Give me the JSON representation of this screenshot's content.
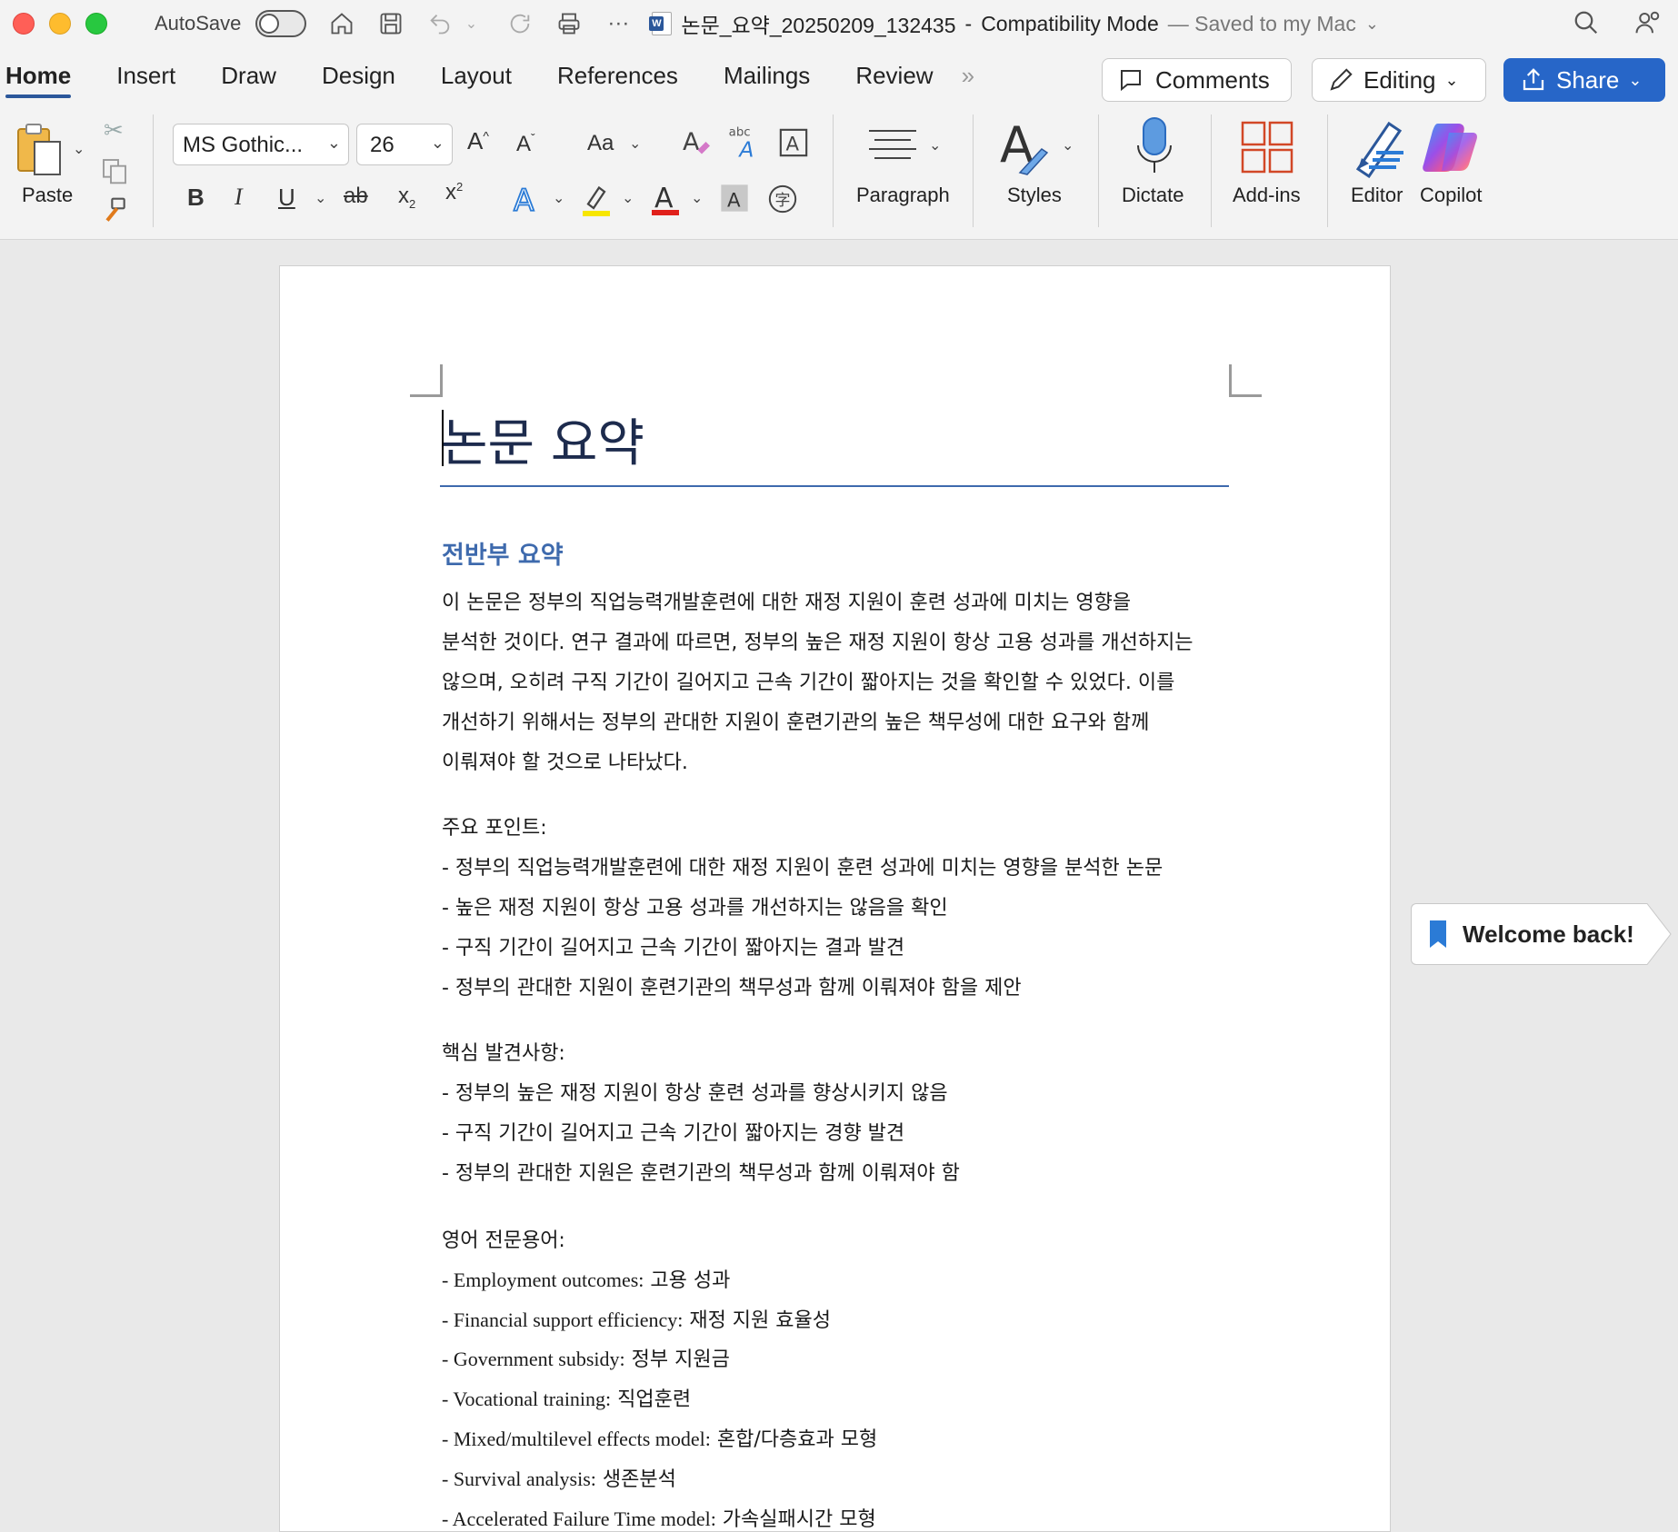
{
  "titlebar": {
    "autosave_label": "AutoSave",
    "doc_name": "논문_요약_20250209_132435",
    "separator": "-",
    "mode": "Compatibility Mode",
    "saved_status": "— Saved to my Mac"
  },
  "tabs": [
    "Home",
    "Insert",
    "Draw",
    "Design",
    "Layout",
    "References",
    "Mailings",
    "Review"
  ],
  "active_tab": "Home",
  "header_buttons": {
    "comments": "Comments",
    "editing": "Editing",
    "share": "Share"
  },
  "ribbon": {
    "paste_label": "Paste",
    "font_name": "MS Gothic...",
    "font_size": "26",
    "grow_font": "A",
    "shrink_font": "A",
    "change_case": "Aa",
    "bold": "B",
    "italic": "I",
    "underline": "U",
    "strikethrough": "ab",
    "subscript": "x",
    "superscript": "x",
    "paragraph_label": "Paragraph",
    "styles_label": "Styles",
    "dictate_label": "Dictate",
    "addins_label": "Add-ins",
    "editor_label": "Editor",
    "copilot_label": "Copilot",
    "highlight_color": "#f7e600",
    "font_color": "#e0201b"
  },
  "document": {
    "title": "논문 요약",
    "section_heading": "전반부 요약",
    "summary_lines": [
      "이 논문은 정부의 직업능력개발훈련에 대한 재정 지원이 훈련 성과에 미치는 영향을",
      "분석한 것이다. 연구 결과에 따르면, 정부의 높은 재정 지원이 항상 고용 성과를 개선하지는",
      "않으며, 오히려 구직 기간이 길어지고 근속 기간이 짧아지는 것을 확인할 수 있었다. 이를",
      "개선하기 위해서는 정부의 관대한 지원이 훈련기관의 높은 책무성에 대한 요구와 함께",
      "이뤄져야 할 것으로 나타났다."
    ],
    "key_points_title": "주요 포인트:",
    "key_points": [
      "- 정부의 직업능력개발훈련에 대한 재정 지원이 훈련 성과에 미치는 영향을 분석한 논문",
      "- 높은 재정 지원이 항상 고용 성과를 개선하지는 않음을 확인",
      "- 구직 기간이 길어지고 근속 기간이 짧아지는 결과 발견",
      "- 정부의 관대한 지원이 훈련기관의 책무성과 함께 이뤄져야 함을 제안"
    ],
    "findings_title": "핵심 발견사항:",
    "findings": [
      "- 정부의 높은 재정 지원이 항상 훈련 성과를 향상시키지 않음",
      "- 구직 기간이 길어지고 근속 기간이 짧아지는 경향 발견",
      "- 정부의 관대한 지원은 훈련기관의 책무성과 함께 이뤄져야 함"
    ],
    "terms_title": "영어 전문용어:",
    "terms": [
      {
        "en": "- Employment outcomes:",
        "ko": " 고용 성과"
      },
      {
        "en": "- Financial support efficiency:",
        "ko": " 재정 지원 효율성"
      },
      {
        "en": "- Government subsidy:",
        "ko": " 정부 지원금"
      },
      {
        "en": "- Vocational training:",
        "ko": " 직업훈련"
      },
      {
        "en": "- Mixed/multilevel effects model:",
        "ko": " 혼합/다층효과 모형"
      },
      {
        "en": "- Survival analysis:",
        "ko": " 생존분석"
      },
      {
        "en": "- Accelerated Failure Time model:",
        "ko": " 가속실패시간 모형"
      }
    ]
  },
  "welcome_popup": "Welcome back!"
}
